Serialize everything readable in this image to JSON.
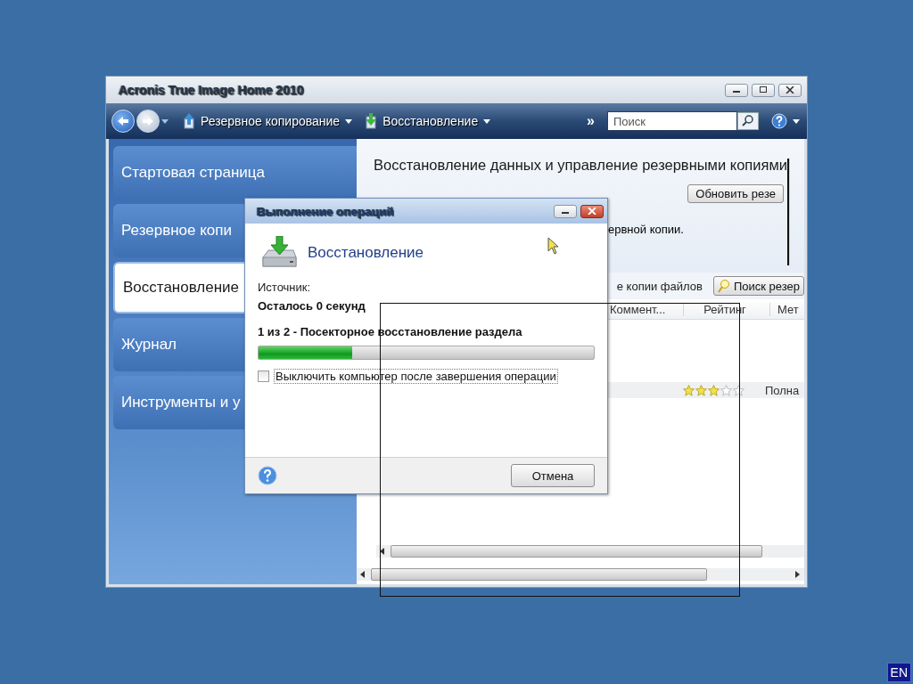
{
  "desktop": {
    "language": "EN"
  },
  "window": {
    "title": "Acronis True Image Home 2010"
  },
  "toolbar": {
    "menus": [
      {
        "label": "Резервное копирование",
        "kind": "backup"
      },
      {
        "label": "Восстановление",
        "kind": "recovery"
      }
    ],
    "overflow": "»",
    "search": {
      "placeholder": "Поиск"
    }
  },
  "sidebar": {
    "items": [
      {
        "label": "Стартовая страница",
        "selected": false
      },
      {
        "label": "Резервное копи",
        "selected": false
      },
      {
        "label": "Восстановление",
        "selected": true
      },
      {
        "label": "Журнал",
        "selected": false
      },
      {
        "label": "Инструменты и у",
        "selected": false
      }
    ]
  },
  "content": {
    "heading": "Восстановление данных и управление резервными копиями",
    "refresh_button": "Обновить резе",
    "description": "ервной копии.",
    "files_link": "е копии файлов",
    "search_button": "Поиск резер",
    "table": {
      "columns": [
        "Коммент...",
        "Рейтинг",
        "Мет"
      ],
      "rows": [
        {
          "stars": 3,
          "method": "Полна"
        }
      ]
    }
  },
  "dialog": {
    "title": "Выполнение операций",
    "operation": "Восстановление",
    "source_label": "Источник:",
    "remaining": "Осталось 0 секунд",
    "step": "1 из 2 - Посекторное восстановление раздела",
    "progress": {
      "level": 0.28
    },
    "shutdown": {
      "label": "Выключить компьютер после завершения операции",
      "checked": false
    },
    "cancel_button": "Отмена"
  }
}
